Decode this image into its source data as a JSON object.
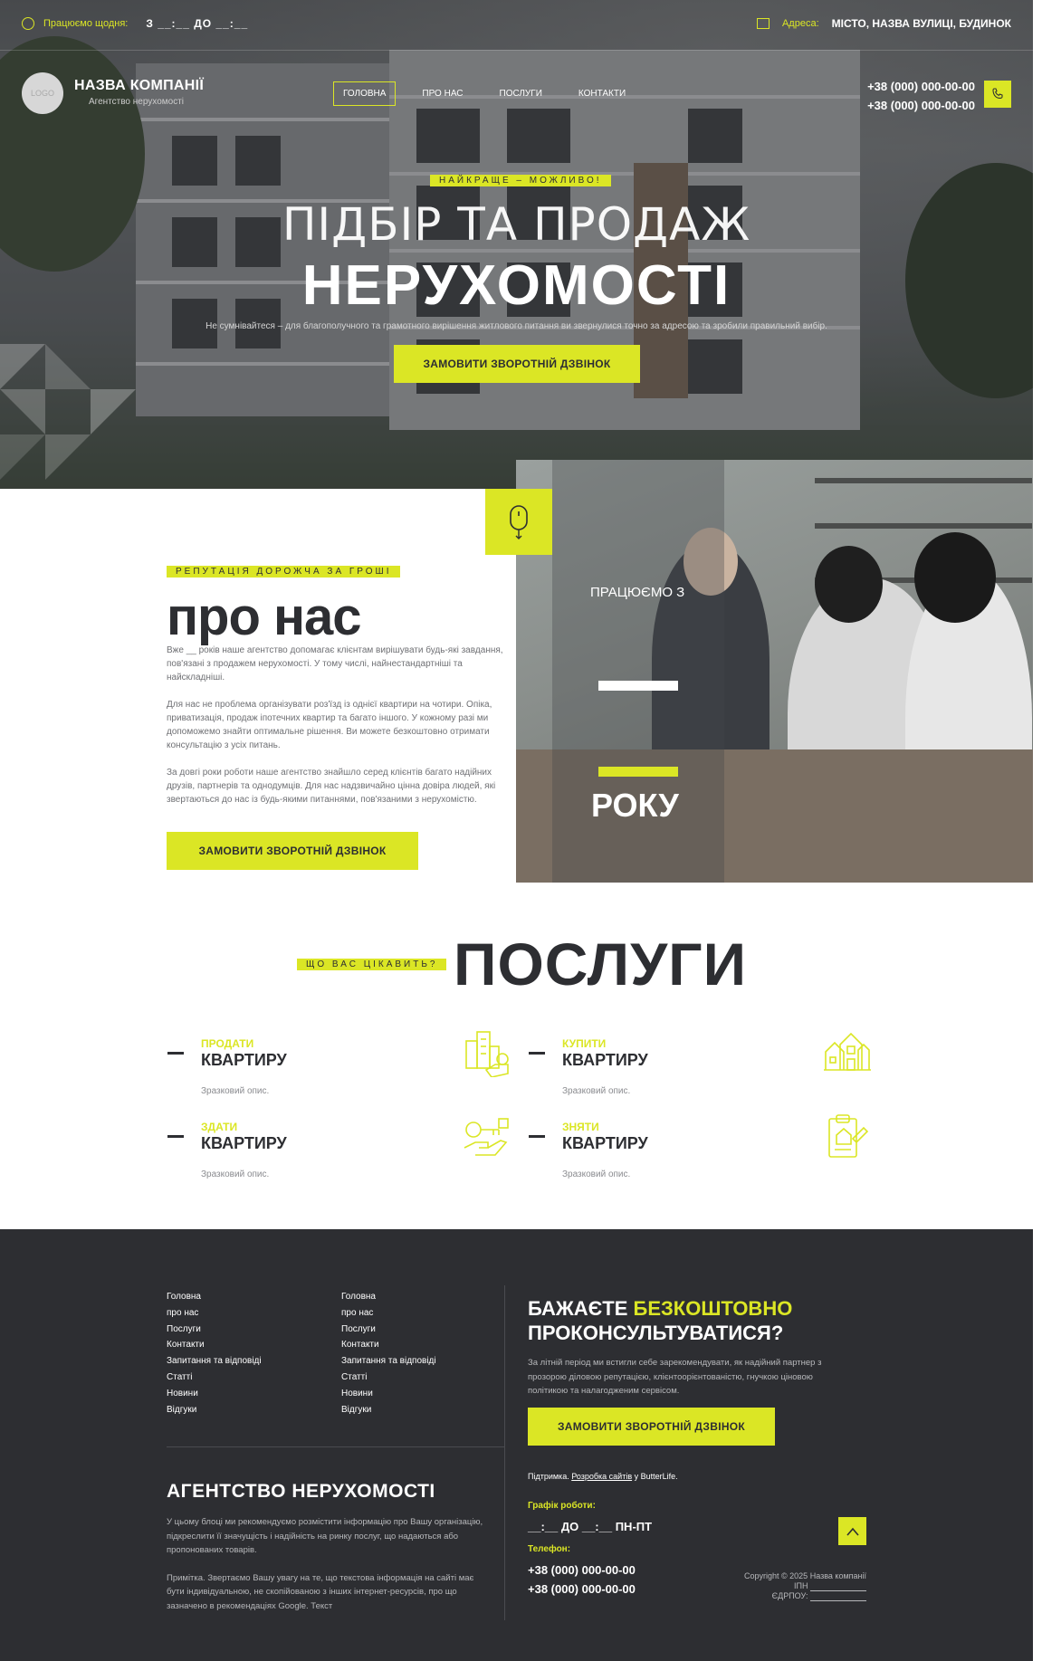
{
  "topbar": {
    "hours_label": "Працюємо щодня:",
    "hours_value": "З __:__ ДО __:__",
    "address_label": "Адреса:",
    "address_value": "МІСТО, НАЗВА ВУЛИЦІ, БУДИНОК"
  },
  "header": {
    "logo_text": "LOGO",
    "company_name": "НАЗВА КОМПАНІЇ",
    "company_sub": "Агентство нерухомості",
    "nav": [
      "ГОЛОВНА",
      "ПРО НАС",
      "ПОСЛУГИ",
      "КОНТАКТИ"
    ],
    "phones": [
      "+38 (000) 000-00-00",
      "+38 (000) 000-00-00"
    ]
  },
  "hero": {
    "tag": "НАЙКРАЩЕ – МОЖЛИВО!",
    "title_line1": "ПІДБІР ТА ПРОДАЖ",
    "title_line2": "НЕРУХОМОСТІ",
    "subtitle": "Не сумнівайтеся – для благополучного та грамотного вирішення житлового питання ви звернулися точно за адресою та зробили правильний вибір.",
    "cta": "ЗАМОВИТИ ЗВОРОТНІЙ ДЗВІНОК"
  },
  "about": {
    "tag": "РЕПУТАЦІЯ ДОРОЖЧА ЗА ГРОШІ",
    "title": "про нас",
    "paragraphs": [
      "Вже __ років наше агентство допомагає клієнтам вирішувати будь-які завдання, пов'язані з продажем нерухомості. У тому числі, найнестандартніші та найскладніші.",
      "Для нас не проблема організувати роз'їзд із однієї квартири на чотири. Опіка, приватизація, продаж іпотечних квартир та багато іншого. У кожному разі ми допоможемо знайти оптимальне рішення. Ви можете безкоштовно отримати консультацію з усіх питань.",
      "За довгі роки роботи наше агентство знайшло серед клієнтів багато надійних друзів, партнерів та однодумців. Для нас надзвичайно цінна довіра людей, які звертаються до нас із будь-якими питаннями, пов'язаними з нерухомістю."
    ],
    "cta": "ЗАМОВИТИ ЗВОРОТНІЙ ДЗВІНОК",
    "since_label": "ПРАЦЮЄМО З",
    "years_label": "РОКУ"
  },
  "services": {
    "tag": "ЩО ВАС ЦІКАВИТЬ?",
    "title": "ПОСЛУГИ",
    "items": [
      {
        "kicker": "ПРОДАТИ",
        "title": "КВАРТИРУ",
        "desc": "Зразковий опис.",
        "icon": "buildings-hand-icon"
      },
      {
        "kicker": "КУПИТИ",
        "title": "КВАРТИРУ",
        "desc": "Зразковий опис.",
        "icon": "houses-icon"
      },
      {
        "kicker": "ЗДАТИ",
        "title": "КВАРТИРУ",
        "desc": "Зразковий опис.",
        "icon": "key-hand-icon"
      },
      {
        "kicker": "ЗНЯТИ",
        "title": "КВАРТИРУ",
        "desc": "Зразковий опис.",
        "icon": "contract-icon"
      }
    ]
  },
  "footer": {
    "links_col1": [
      "Головна",
      "про нас",
      "Послуги",
      "Контакти",
      "Запитання та відповіді",
      "Статті",
      "Новини",
      "Відгуки"
    ],
    "links_col2": [
      "Головна",
      "про нас",
      "Послуги",
      "Контакти",
      "Запитання та відповіді",
      "Статті",
      "Новини",
      "Відгуки"
    ],
    "agency_title": "АГЕНТСТВО НЕРУХОМОСТІ",
    "agency_text": [
      "У цьому блоці ми рекомендуємо розмістити інформацію про Вашу організацію, підкреслити її значущість і надійність на ринку послуг, що надаються або пропонованих товарів.",
      "Примітка. Звертаємо Вашу увагу на те, що текстова інформація на сайті має бути індивідуальною, не скопійованою з інших інтернет-ресурсів, про що зазначено в рекомендаціях Google. Текст"
    ],
    "consult_line1_a": "БАЖАЄТЕ ",
    "consult_line1_b": "БЕЗКОШТОВНО",
    "consult_line2": "ПРОКОНСУЛЬТУВАТИСЯ?",
    "consult_text": "За літній період ми встигли себе зарекомендувати, як надійний партнер з прозорою діловою репутацією, клієнтоорієнтованістю, гнучкою ціновою політикою та налагодженим сервісом.",
    "cta": "ЗАМОВИТИ ЗВОРОТНІЙ ДЗВІНОК",
    "support_a": "Підтримка. ",
    "support_link": "Розробка сайтів",
    "support_b": " у ButterLife.",
    "schedule_label": "Графік роботи:",
    "schedule_value": "__:__ ДО __:__ ПН-ПТ",
    "phone_label": "Телефон:",
    "phones": [
      "+38 (000) 000-00-00",
      "+38 (000) 000-00-00"
    ],
    "copyright": "Copyright © 2025 Назва компанії",
    "ipn_label": "ІПН",
    "edrpou_label": "ЄДРПОУ:"
  }
}
